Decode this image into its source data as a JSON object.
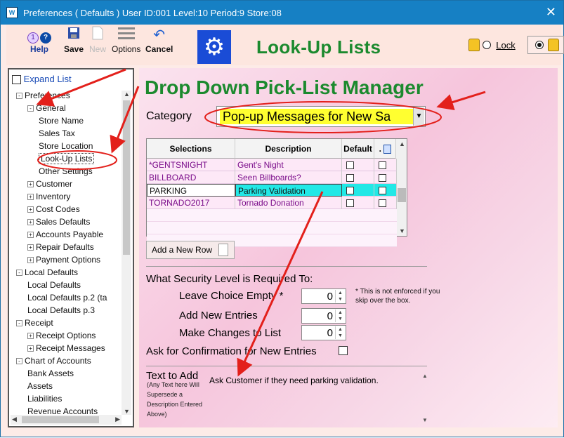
{
  "window": {
    "title": "Preferences ( Defaults )   User ID:001 Level:10 Period:9 Store:08",
    "close_glyph": "✕"
  },
  "toolbar": {
    "help_label": "Help",
    "save_label": "Save",
    "new_label": "New",
    "options_label": "Options",
    "cancel_label": "Cancel",
    "help_badge": "1"
  },
  "header": {
    "title": "Look-Up Lists",
    "lock_label": "Lock"
  },
  "sidebar": {
    "expand_label": "Expand List",
    "tree": [
      {
        "label": "Preferences",
        "level": 0,
        "toggle": "-"
      },
      {
        "label": "General",
        "level": 1,
        "toggle": "-"
      },
      {
        "label": "Store Name",
        "level": 2,
        "toggle": ""
      },
      {
        "label": "Sales Tax",
        "level": 2,
        "toggle": ""
      },
      {
        "label": "Store Location",
        "level": 2,
        "toggle": ""
      },
      {
        "label": "Look-Up Lists",
        "level": 2,
        "toggle": "",
        "selected": true
      },
      {
        "label": "Other Settings",
        "level": 2,
        "toggle": ""
      },
      {
        "label": "Customer",
        "level": 1,
        "toggle": "+"
      },
      {
        "label": "Inventory",
        "level": 1,
        "toggle": "+"
      },
      {
        "label": "Cost Codes",
        "level": 1,
        "toggle": "+"
      },
      {
        "label": "Sales Defaults",
        "level": 1,
        "toggle": "+"
      },
      {
        "label": "Accounts Payable",
        "level": 1,
        "toggle": "+"
      },
      {
        "label": "Repair Defaults",
        "level": 1,
        "toggle": "+"
      },
      {
        "label": "Payment Options",
        "level": 1,
        "toggle": "+"
      },
      {
        "label": "Local Defaults",
        "level": 0,
        "toggle": "-"
      },
      {
        "label": "Local Defaults",
        "level": 1,
        "toggle": ""
      },
      {
        "label": "Local Defaults p.2 (ta",
        "level": 1,
        "toggle": ""
      },
      {
        "label": "Local Defaults p.3",
        "level": 1,
        "toggle": ""
      },
      {
        "label": "Receipt",
        "level": 0,
        "toggle": "-"
      },
      {
        "label": "Receipt Options",
        "level": 1,
        "toggle": "+"
      },
      {
        "label": "Receipt Messages",
        "level": 1,
        "toggle": "+"
      },
      {
        "label": "Chart of Accounts",
        "level": 0,
        "toggle": "-"
      },
      {
        "label": "Bank Assets",
        "level": 1,
        "toggle": ""
      },
      {
        "label": "Assets",
        "level": 1,
        "toggle": ""
      },
      {
        "label": "Liabilities",
        "level": 1,
        "toggle": ""
      },
      {
        "label": "Revenue Accounts",
        "level": 1,
        "toggle": ""
      }
    ]
  },
  "main": {
    "title": "Drop Down Pick-List Manager",
    "category_label": "Category",
    "category_value": "Pop-up Messages for New Sa",
    "grid": {
      "headers": [
        "Selections",
        "Description",
        "Default",
        "."
      ],
      "rows": [
        {
          "selection": "*GENTSNIGHT",
          "description": "Gent's Night"
        },
        {
          "selection": "BILLBOARD",
          "description": "Seen Billboards?"
        },
        {
          "selection": "PARKING",
          "description": "Parking Validation"
        },
        {
          "selection": "TORNADO2017",
          "description": "Tornado Donation"
        }
      ]
    },
    "add_row_label": "Add a New Row",
    "security_heading": "What Security Level is Required To:",
    "security": [
      {
        "label": "Leave Choice Empty *",
        "value": "0"
      },
      {
        "label": "Add New Entries",
        "value": "0"
      },
      {
        "label": "Make Changes to List",
        "value": "0"
      }
    ],
    "note": "* This is not  enforced if you skip over the box.",
    "confirm_label": "Ask for Confirmation for New Entries",
    "text_add_label": "Text to Add",
    "text_add_note": "(Any Text here Will Supersede a Description Entered Above)",
    "text_add_value": "Ask Customer if they need parking validation."
  }
}
